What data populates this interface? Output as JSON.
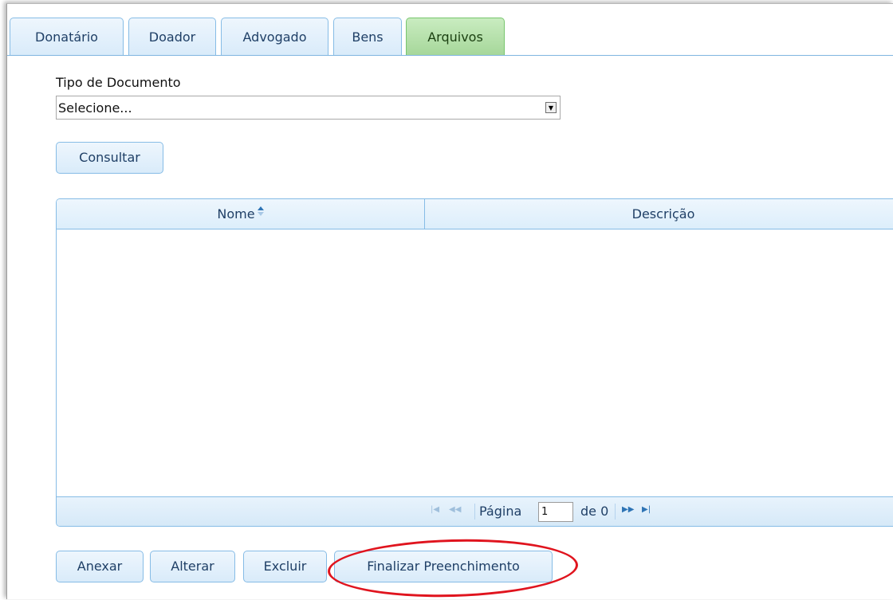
{
  "tabs": [
    {
      "label": "Donatário"
    },
    {
      "label": "Doador"
    },
    {
      "label": "Advogado"
    },
    {
      "label": "Bens"
    },
    {
      "label": "Arquivos"
    }
  ],
  "active_tab": "Arquivos",
  "form": {
    "tipo_label": "Tipo de Documento",
    "tipo_selected": "Selecione...",
    "consultar_label": "Consultar"
  },
  "table": {
    "columns": [
      {
        "label": "Nome",
        "sort": "ascending"
      },
      {
        "label": "Descrição"
      }
    ],
    "rows": []
  },
  "pager": {
    "page_label": "Página",
    "page_value": "1",
    "of_label": "de 0"
  },
  "actions": {
    "anexar": "Anexar",
    "alterar": "Alterar",
    "excluir": "Excluir",
    "finalizar": "Finalizar Preenchimento"
  },
  "colors": {
    "tab_border": "#86bce6",
    "active_tab_bg": "#a6d79a",
    "highlight": "#e0141e",
    "text": "#1f3f66"
  }
}
